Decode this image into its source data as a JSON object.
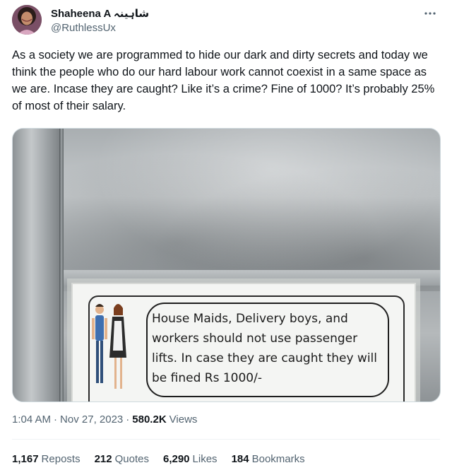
{
  "user": {
    "display_name": "Shaheena A شاہینہ",
    "handle": "@RuthlessUx"
  },
  "tweet": {
    "text": "As a society we are programmed to hide our dark and dirty secrets and today we think the people who do our hard labour work cannot coexist in a same space as we are. Incase they are caught? Like it’s a crime? Fine of 1000? It’s probably 25% of most of their salary."
  },
  "media": {
    "sign_text": "House Maids, Delivery boys, and workers should not use passenger lifts. In case they are caught they will be fined Rs 1000/-"
  },
  "meta": {
    "time": "1:04 AM",
    "date": "Nov 27, 2023",
    "separator": "·",
    "views_count": "580.2K",
    "views_label": "Views"
  },
  "stats": {
    "reposts": {
      "count": "1,167",
      "label": "Reposts"
    },
    "quotes": {
      "count": "212",
      "label": "Quotes"
    },
    "likes": {
      "count": "6,290",
      "label": "Likes"
    },
    "bookmarks": {
      "count": "184",
      "label": "Bookmarks"
    }
  },
  "icons": {
    "more": "more-horizontal-icon"
  },
  "colors": {
    "text_primary": "#0f1419",
    "text_secondary": "#536471",
    "border": "#cfd9de"
  }
}
